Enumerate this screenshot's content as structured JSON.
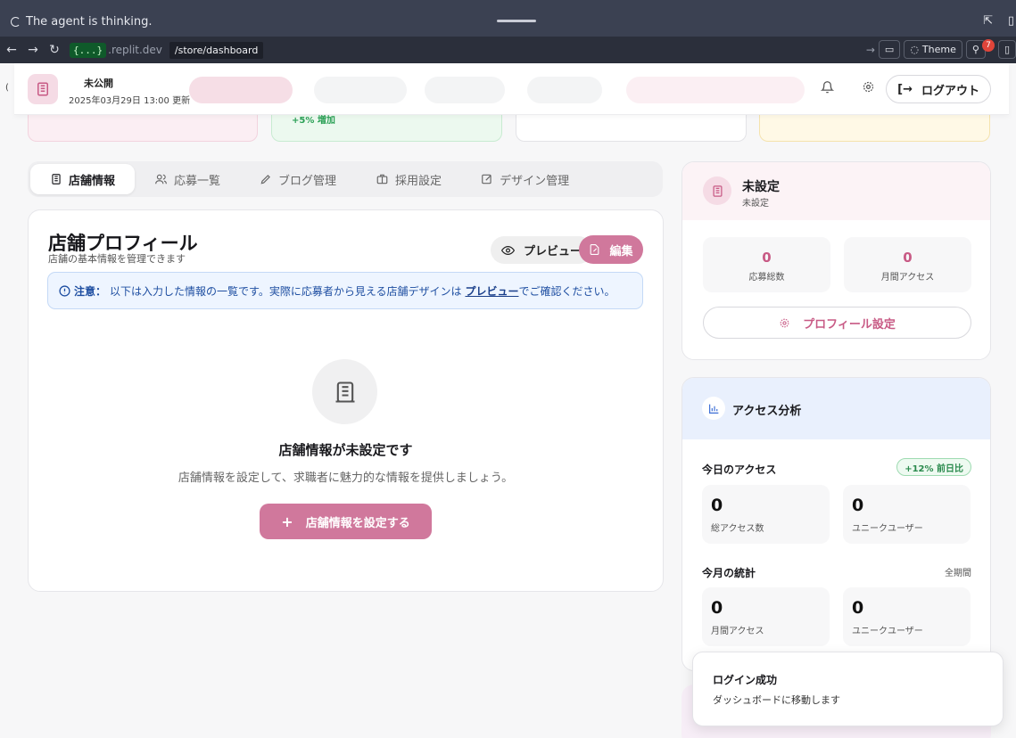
{
  "agent_bar": {
    "status": "The agent is thinking."
  },
  "browser": {
    "domain_badge": "{...}",
    "domain_suffix": ".replit.dev",
    "path": "/store/dashboard",
    "theme_label": "Theme",
    "notification_count": "7"
  },
  "header": {
    "status": "未公開",
    "updated": "2025年03月29日 13:00 更新",
    "logout_label": "ログアウト"
  },
  "stats": {
    "delta_text": "+5% 増加"
  },
  "tabs": [
    {
      "label": "店舗情報",
      "icon": "building-icon",
      "active": true
    },
    {
      "label": "応募一覧",
      "icon": "users-icon",
      "active": false
    },
    {
      "label": "ブログ管理",
      "icon": "pen-icon",
      "active": false
    },
    {
      "label": "採用設定",
      "icon": "briefcase-icon",
      "active": false
    },
    {
      "label": "デザイン管理",
      "icon": "edit-icon",
      "active": false
    }
  ],
  "profile": {
    "title": "店舗プロフィール",
    "subtitle": "店舗の基本情報を管理できます",
    "preview_label": "プレビュー",
    "edit_label": "編集",
    "notice_prefix": "注意：",
    "notice_text": "以下は入力した情報の一覧です。実際に応募者から見える店舗デザインは",
    "notice_link": "プレビュー",
    "notice_suffix": "でご確認ください。",
    "empty_title": "店舗情報が未設定です",
    "empty_desc": "店舗情報を設定して、求職者に魅力的な情報を提供しましょう。",
    "setup_label": "店舗情報を設定する"
  },
  "store": {
    "name": "未設定",
    "sub": "未設定",
    "applications_value": "0",
    "applications_label": "応募総数",
    "monthly_access_value": "0",
    "monthly_access_label": "月間アクセス",
    "profile_setting_label": "プロフィール設定"
  },
  "access": {
    "title": "アクセス分析",
    "today_title": "今日のアクセス",
    "trend": "+12% 前日比",
    "today_total_value": "0",
    "today_total_label": "総アクセス数",
    "today_unique_value": "0",
    "today_unique_label": "ユニークユーザー",
    "month_title": "今月の統計",
    "period": "全期間",
    "month_access_value": "0",
    "month_access_label": "月間アクセス",
    "month_unique_value": "0",
    "month_unique_label": "ユニークユーザー"
  },
  "toast": {
    "title": "ログイン成功",
    "desc": "ダッシュボードに移動します"
  },
  "colors": {
    "accent_pink": "#d0789c",
    "accent_blue": "#3d6fd6",
    "success_green": "#2a8a4d"
  }
}
